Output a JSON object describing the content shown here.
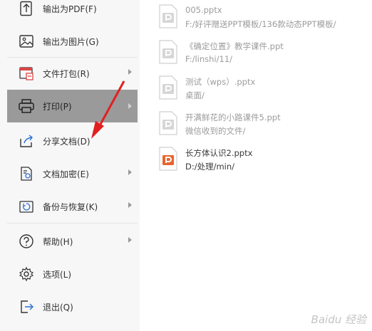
{
  "menu": {
    "items": [
      {
        "label": "输出为PDF(F)",
        "icon": "pdf-export-icon",
        "submenu": false
      },
      {
        "label": "输出为图片(G)",
        "icon": "image-export-icon",
        "submenu": false
      },
      {
        "label": "文件打包(R)",
        "icon": "package-icon",
        "submenu": true
      },
      {
        "label": "打印(P)",
        "icon": "printer-icon",
        "submenu": true
      },
      {
        "label": "分享文档(D)",
        "icon": "share-icon",
        "submenu": false
      },
      {
        "label": "文档加密(E)",
        "icon": "encrypt-icon",
        "submenu": true
      },
      {
        "label": "备份与恢复(K)",
        "icon": "backup-icon",
        "submenu": true
      },
      {
        "label": "帮助(H)",
        "icon": "help-icon",
        "submenu": true
      },
      {
        "label": "选项(L)",
        "icon": "gear-icon",
        "submenu": false
      },
      {
        "label": "退出(Q)",
        "icon": "exit-icon",
        "submenu": false
      }
    ],
    "active_item": "打印(P)"
  },
  "recent_files": [
    {
      "name": "005.pptx",
      "path": "F:/好评赠送PPT模板/136款动态PPT模板/"
    },
    {
      "name": "《确定位置》教学课件.ppt",
      "path": "F:/linshi/11/"
    },
    {
      "name": "测试（wps）.pptx",
      "path": "桌面/"
    },
    {
      "name": "开满鲜花的小路课件5.ppt",
      "path": "微信收到的文件/"
    },
    {
      "name": "长方体认识2.pptx",
      "path": "D:/处理/min/"
    }
  ],
  "watermark": "Baidu 经验",
  "colors": {
    "accent_orange": "#e8642c",
    "active_bg": "#9a9a9a",
    "annotation_red": "#e02020"
  }
}
